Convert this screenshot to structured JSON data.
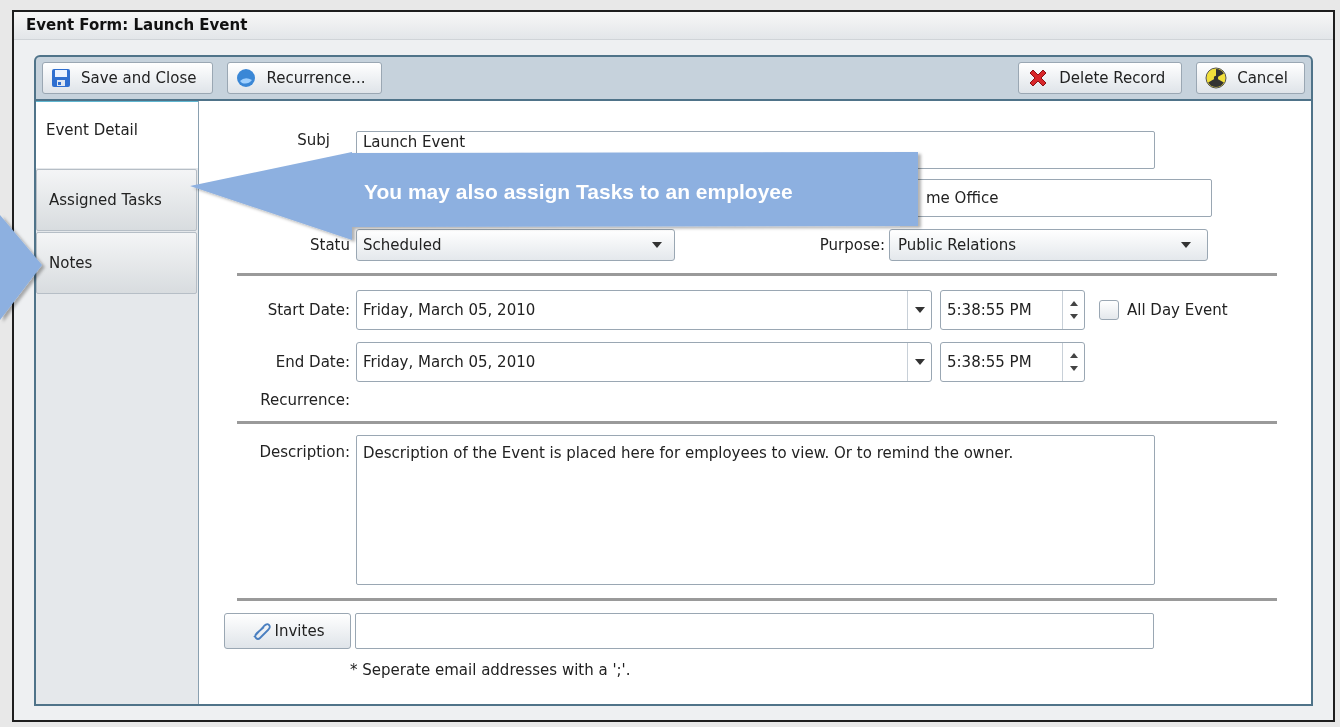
{
  "window": {
    "title": "Event Form: Launch Event"
  },
  "toolbar": {
    "left": [
      {
        "label": "Save and Close"
      },
      {
        "label": "Recurrence..."
      }
    ],
    "right": [
      {
        "label": "Delete Record"
      },
      {
        "label": "Cancel"
      }
    ]
  },
  "tabs": [
    {
      "label": "Event Detail",
      "selected": true
    },
    {
      "label": "Assigned Tasks",
      "selected": false
    },
    {
      "label": "Notes",
      "selected": false
    }
  ],
  "form": {
    "subject": {
      "label": "Subj",
      "value": "Launch Event"
    },
    "location": {
      "value": "me Office"
    },
    "status": {
      "label": "Statu",
      "value": "Scheduled"
    },
    "purpose": {
      "label": "Purpose:",
      "value": "Public Relations"
    },
    "start": {
      "label": "Start Date:",
      "date": "Friday, March 05, 2010",
      "time": "5:38:55 PM"
    },
    "all_day": {
      "label": "All Day Event",
      "checked": false
    },
    "end": {
      "label": "End Date:",
      "date": "Friday, March 05, 2010",
      "time": "5:38:55 PM"
    },
    "recurrence": {
      "label": "Recurrence:"
    },
    "description": {
      "label": "Description:",
      "value": "Description of the Event is placed here for employees to view. Or to remind the owner."
    },
    "invites": {
      "button": "Invites",
      "note": "* Seperate email addresses with a ';'."
    }
  },
  "callout": {
    "text": "You may also assign Tasks to an employee"
  }
}
